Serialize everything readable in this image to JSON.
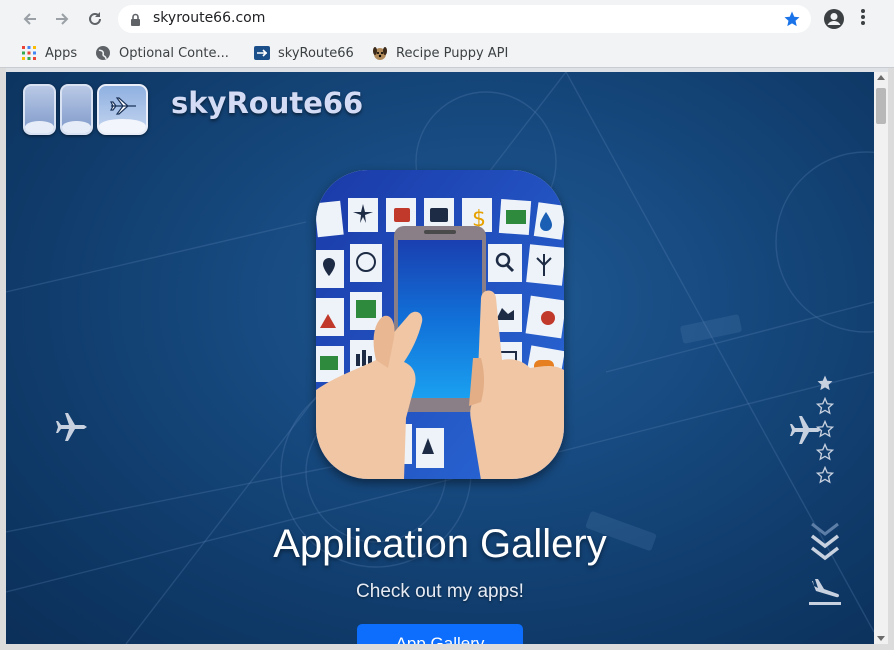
{
  "browser": {
    "url": "skyroute66.com",
    "bookmarks": [
      {
        "label": "Apps",
        "icon": "apps-grid-icon"
      },
      {
        "label": "Optional Conte...",
        "icon": "globe-icon"
      },
      {
        "label": "skyRoute66",
        "icon": "skyroute-favicon"
      },
      {
        "label": "Recipe Puppy API",
        "icon": "puppy-favicon"
      }
    ]
  },
  "site": {
    "brand": "skyRoute66",
    "headline": "Application Gallery",
    "subtitle": "Check out my apps!",
    "cta_label": "App Gallery",
    "rating": {
      "filled": 1,
      "total": 5
    }
  },
  "colors": {
    "accent": "#0d6efd",
    "background": "#174a80",
    "brand_text": "#d4dcf5"
  }
}
